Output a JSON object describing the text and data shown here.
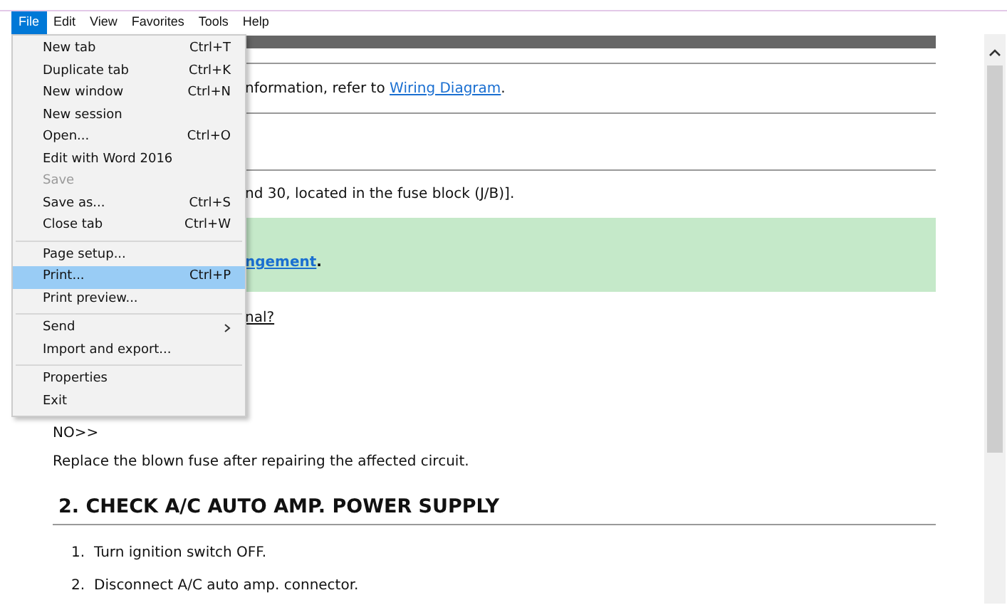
{
  "menubar": [
    {
      "label": "File",
      "selected": true
    },
    {
      "label": "Edit",
      "selected": false
    },
    {
      "label": "View",
      "selected": false
    },
    {
      "label": "Favorites",
      "selected": false
    },
    {
      "label": "Tools",
      "selected": false
    },
    {
      "label": "Help",
      "selected": false
    }
  ],
  "file_menu": [
    {
      "label": "New tab",
      "shortcut": "Ctrl+T",
      "disabled": false,
      "selected": false,
      "kind": "item"
    },
    {
      "label": "Duplicate tab",
      "shortcut": "Ctrl+K",
      "disabled": false,
      "selected": false,
      "kind": "item"
    },
    {
      "label": "New window",
      "shortcut": "Ctrl+N",
      "disabled": false,
      "selected": false,
      "kind": "item"
    },
    {
      "label": "New session",
      "disabled": false,
      "selected": false,
      "kind": "item"
    },
    {
      "label": "Open...",
      "shortcut": "Ctrl+O",
      "disabled": false,
      "selected": false,
      "kind": "item"
    },
    {
      "label": "Edit with Word 2016",
      "disabled": false,
      "selected": false,
      "kind": "item"
    },
    {
      "label": "Save",
      "disabled": true,
      "selected": false,
      "kind": "item"
    },
    {
      "label": "Save as...",
      "shortcut": "Ctrl+S",
      "disabled": false,
      "selected": false,
      "kind": "item"
    },
    {
      "label": "Close tab",
      "shortcut": "Ctrl+W",
      "disabled": false,
      "selected": false,
      "kind": "item"
    },
    {
      "kind": "separator"
    },
    {
      "label": "Page setup...",
      "disabled": false,
      "selected": false,
      "kind": "item"
    },
    {
      "label": "Print...",
      "shortcut": "Ctrl+P",
      "disabled": false,
      "selected": true,
      "kind": "item"
    },
    {
      "label": "Print preview...",
      "disabled": false,
      "selected": false,
      "kind": "item"
    },
    {
      "kind": "separator"
    },
    {
      "label": "Send",
      "disabled": false,
      "selected": false,
      "kind": "submenu"
    },
    {
      "label": "Import and export...",
      "disabled": false,
      "selected": false,
      "kind": "item"
    },
    {
      "kind": "separator"
    },
    {
      "label": "Properties",
      "disabled": false,
      "selected": false,
      "kind": "item"
    },
    {
      "label": "Exit",
      "disabled": false,
      "selected": false,
      "kind": "item"
    }
  ],
  "document": {
    "info_text": "nformation, refer to ",
    "info_link": "Wiring Diagram",
    "info_end": ".",
    "fuse_text": "nd 30, located in the fuse block (J/B)].",
    "note_link": "ngement",
    "note_end": ".",
    "question": "nal?",
    "no_label": "NO>>",
    "replace_text": "Replace the blown fuse after repairing the affected circuit.",
    "heading": "2. CHECK A/C AUTO AMP. POWER SUPPLY",
    "steps": [
      {
        "number": "1.",
        "text": "Turn ignition switch OFF."
      },
      {
        "number": "2.",
        "text": "Disconnect A/C auto amp. connector."
      }
    ]
  }
}
